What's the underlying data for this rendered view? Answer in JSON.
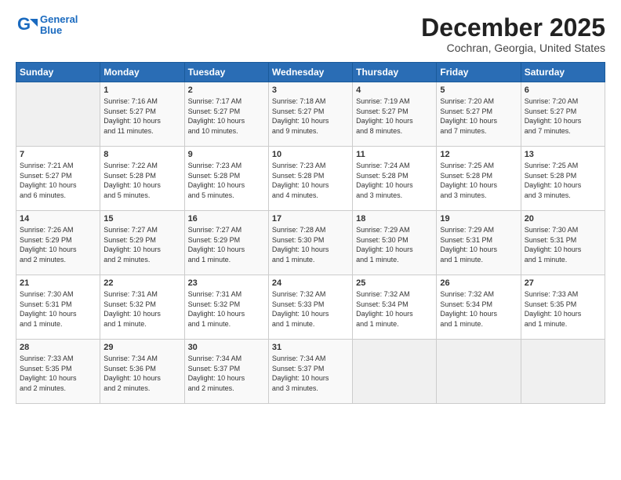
{
  "header": {
    "logo_line1": "General",
    "logo_line2": "Blue",
    "month": "December 2025",
    "location": "Cochran, Georgia, United States"
  },
  "days_of_week": [
    "Sunday",
    "Monday",
    "Tuesday",
    "Wednesday",
    "Thursday",
    "Friday",
    "Saturday"
  ],
  "weeks": [
    [
      {
        "day": "",
        "info": ""
      },
      {
        "day": "1",
        "info": "Sunrise: 7:16 AM\nSunset: 5:27 PM\nDaylight: 10 hours\nand 11 minutes."
      },
      {
        "day": "2",
        "info": "Sunrise: 7:17 AM\nSunset: 5:27 PM\nDaylight: 10 hours\nand 10 minutes."
      },
      {
        "day": "3",
        "info": "Sunrise: 7:18 AM\nSunset: 5:27 PM\nDaylight: 10 hours\nand 9 minutes."
      },
      {
        "day": "4",
        "info": "Sunrise: 7:19 AM\nSunset: 5:27 PM\nDaylight: 10 hours\nand 8 minutes."
      },
      {
        "day": "5",
        "info": "Sunrise: 7:20 AM\nSunset: 5:27 PM\nDaylight: 10 hours\nand 7 minutes."
      },
      {
        "day": "6",
        "info": "Sunrise: 7:20 AM\nSunset: 5:27 PM\nDaylight: 10 hours\nand 7 minutes."
      }
    ],
    [
      {
        "day": "7",
        "info": "Sunrise: 7:21 AM\nSunset: 5:27 PM\nDaylight: 10 hours\nand 6 minutes."
      },
      {
        "day": "8",
        "info": "Sunrise: 7:22 AM\nSunset: 5:28 PM\nDaylight: 10 hours\nand 5 minutes."
      },
      {
        "day": "9",
        "info": "Sunrise: 7:23 AM\nSunset: 5:28 PM\nDaylight: 10 hours\nand 5 minutes."
      },
      {
        "day": "10",
        "info": "Sunrise: 7:23 AM\nSunset: 5:28 PM\nDaylight: 10 hours\nand 4 minutes."
      },
      {
        "day": "11",
        "info": "Sunrise: 7:24 AM\nSunset: 5:28 PM\nDaylight: 10 hours\nand 3 minutes."
      },
      {
        "day": "12",
        "info": "Sunrise: 7:25 AM\nSunset: 5:28 PM\nDaylight: 10 hours\nand 3 minutes."
      },
      {
        "day": "13",
        "info": "Sunrise: 7:25 AM\nSunset: 5:28 PM\nDaylight: 10 hours\nand 3 minutes."
      }
    ],
    [
      {
        "day": "14",
        "info": "Sunrise: 7:26 AM\nSunset: 5:29 PM\nDaylight: 10 hours\nand 2 minutes."
      },
      {
        "day": "15",
        "info": "Sunrise: 7:27 AM\nSunset: 5:29 PM\nDaylight: 10 hours\nand 2 minutes."
      },
      {
        "day": "16",
        "info": "Sunrise: 7:27 AM\nSunset: 5:29 PM\nDaylight: 10 hours\nand 1 minute."
      },
      {
        "day": "17",
        "info": "Sunrise: 7:28 AM\nSunset: 5:30 PM\nDaylight: 10 hours\nand 1 minute."
      },
      {
        "day": "18",
        "info": "Sunrise: 7:29 AM\nSunset: 5:30 PM\nDaylight: 10 hours\nand 1 minute."
      },
      {
        "day": "19",
        "info": "Sunrise: 7:29 AM\nSunset: 5:31 PM\nDaylight: 10 hours\nand 1 minute."
      },
      {
        "day": "20",
        "info": "Sunrise: 7:30 AM\nSunset: 5:31 PM\nDaylight: 10 hours\nand 1 minute."
      }
    ],
    [
      {
        "day": "21",
        "info": "Sunrise: 7:30 AM\nSunset: 5:31 PM\nDaylight: 10 hours\nand 1 minute."
      },
      {
        "day": "22",
        "info": "Sunrise: 7:31 AM\nSunset: 5:32 PM\nDaylight: 10 hours\nand 1 minute."
      },
      {
        "day": "23",
        "info": "Sunrise: 7:31 AM\nSunset: 5:32 PM\nDaylight: 10 hours\nand 1 minute."
      },
      {
        "day": "24",
        "info": "Sunrise: 7:32 AM\nSunset: 5:33 PM\nDaylight: 10 hours\nand 1 minute."
      },
      {
        "day": "25",
        "info": "Sunrise: 7:32 AM\nSunset: 5:34 PM\nDaylight: 10 hours\nand 1 minute."
      },
      {
        "day": "26",
        "info": "Sunrise: 7:32 AM\nSunset: 5:34 PM\nDaylight: 10 hours\nand 1 minute."
      },
      {
        "day": "27",
        "info": "Sunrise: 7:33 AM\nSunset: 5:35 PM\nDaylight: 10 hours\nand 1 minute."
      }
    ],
    [
      {
        "day": "28",
        "info": "Sunrise: 7:33 AM\nSunset: 5:35 PM\nDaylight: 10 hours\nand 2 minutes."
      },
      {
        "day": "29",
        "info": "Sunrise: 7:34 AM\nSunset: 5:36 PM\nDaylight: 10 hours\nand 2 minutes."
      },
      {
        "day": "30",
        "info": "Sunrise: 7:34 AM\nSunset: 5:37 PM\nDaylight: 10 hours\nand 2 minutes."
      },
      {
        "day": "31",
        "info": "Sunrise: 7:34 AM\nSunset: 5:37 PM\nDaylight: 10 hours\nand 3 minutes."
      },
      {
        "day": "",
        "info": ""
      },
      {
        "day": "",
        "info": ""
      },
      {
        "day": "",
        "info": ""
      }
    ]
  ]
}
